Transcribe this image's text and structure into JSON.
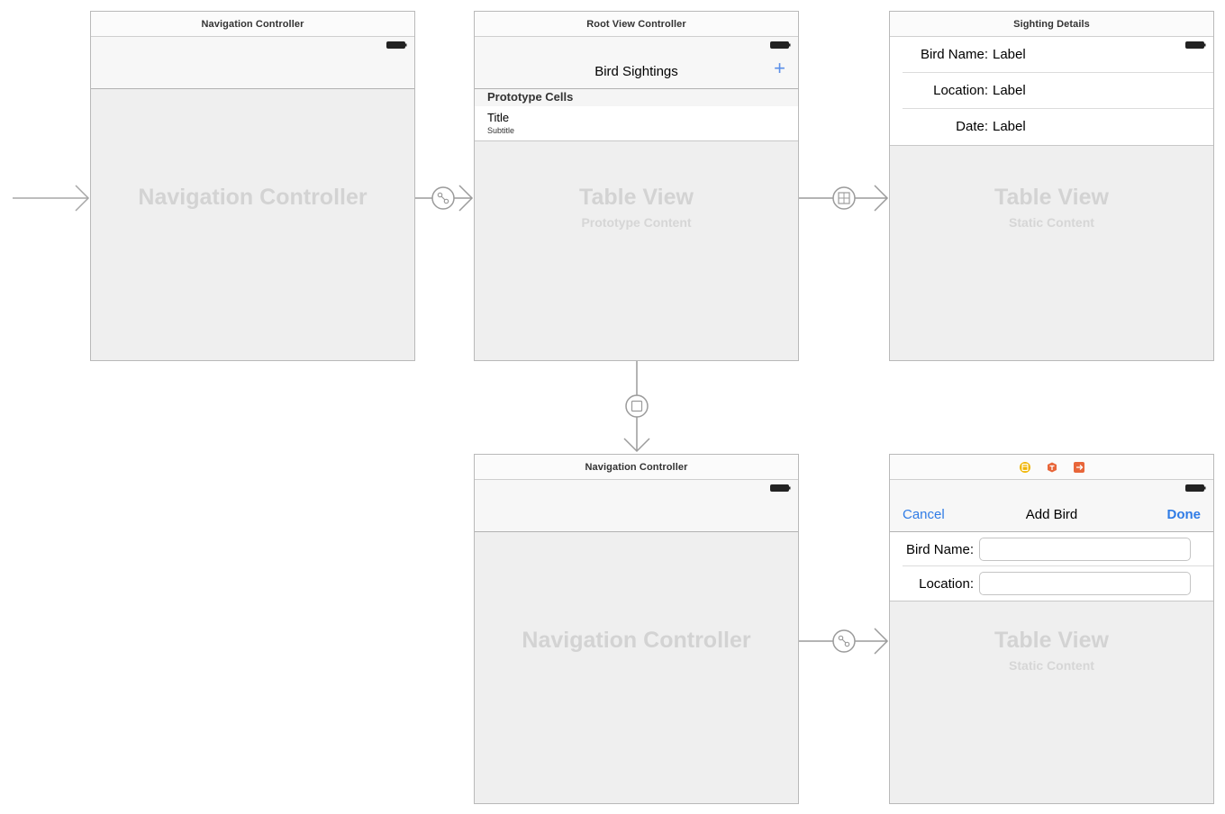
{
  "scenes": {
    "nav1": {
      "dock_title": "Navigation Controller",
      "placeholder": "Navigation Controller"
    },
    "root": {
      "dock_title": "Root View Controller",
      "nav_title": "Bird Sightings",
      "add_glyph": "+",
      "prototype_header": "Prototype Cells",
      "cell_title": "Title",
      "cell_subtitle": "Subtitle",
      "placeholder": "Table View",
      "placeholder_sub": "Prototype Content"
    },
    "details": {
      "dock_title": "Sighting Details",
      "rows": [
        {
          "key": "Bird Name:",
          "value": "Label"
        },
        {
          "key": "Location:",
          "value": "Label"
        },
        {
          "key": "Date:",
          "value": "Label"
        }
      ],
      "placeholder": "Table View",
      "placeholder_sub": "Static Content"
    },
    "nav2": {
      "dock_title": "Navigation Controller",
      "placeholder": "Navigation Controller"
    },
    "add": {
      "cancel_label": "Cancel",
      "nav_title": "Add Bird",
      "done_label": "Done",
      "fields": [
        {
          "label": "Bird Name:",
          "value": ""
        },
        {
          "label": "Location:",
          "value": ""
        }
      ],
      "placeholder": "Table View",
      "placeholder_sub": "Static Content",
      "dock_icons": [
        "view-controller-icon",
        "first-responder-icon",
        "exit-icon"
      ]
    }
  },
  "segues": [
    "initial-arrow",
    "push-segue",
    "show-detail-segue",
    "modal-segue",
    "root-relationship-segue"
  ],
  "colors": {
    "tint": "#2f7ce6",
    "add_plus": "#5b8fe8",
    "connector": "#9b9b9b",
    "dock_yellow": "#f0b400",
    "dock_orange": "#e8663a"
  }
}
